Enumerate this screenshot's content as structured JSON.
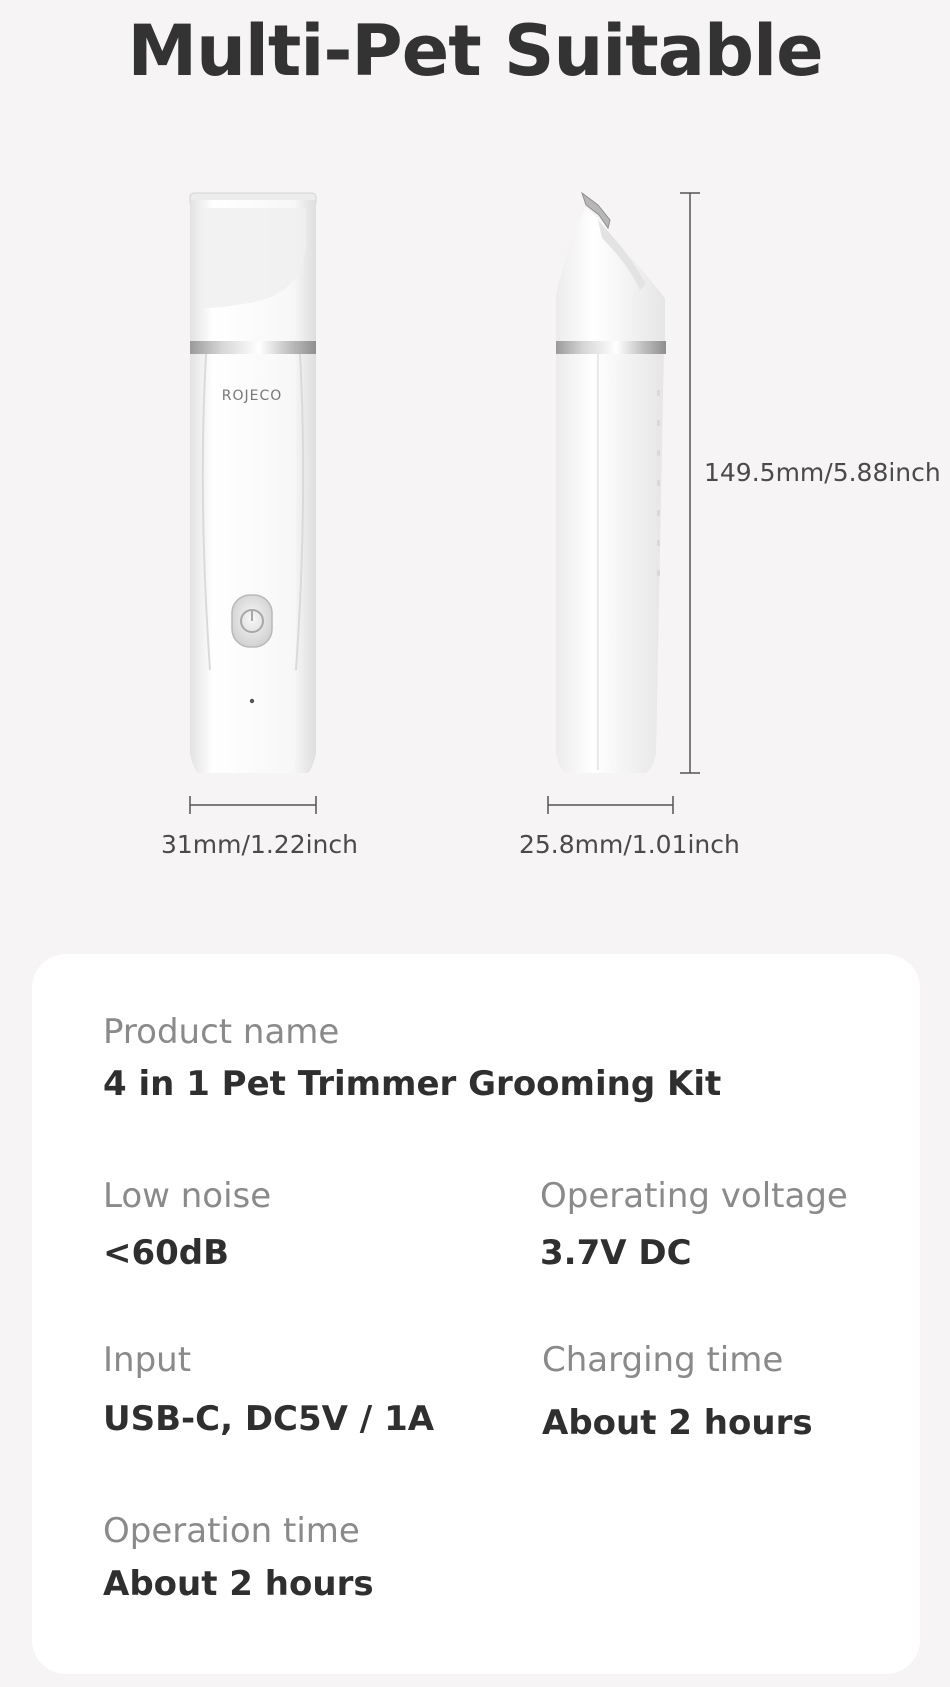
{
  "page": {
    "title": "Multi-Pet Suitable"
  },
  "product": {
    "brand": "ROJECO",
    "dimensions": {
      "height": "149.5mm/5.88inch",
      "front_width": "31mm/1.22inch",
      "side_width": "25.8mm/1.01inch"
    }
  },
  "specs": {
    "product_name": {
      "label": "Product name",
      "value": "4 in 1 Pet Trimmer Grooming Kit"
    },
    "low_noise": {
      "label": "Low noise",
      "value": "<60dB"
    },
    "operating_voltage": {
      "label": "Operating voltage",
      "value": "3.7V DC"
    },
    "input": {
      "label": "Input",
      "value": "USB-C, DC5V / 1A"
    },
    "charging_time": {
      "label": "Charging time",
      "value": "About 2 hours"
    },
    "operation_time": {
      "label": "Operation time",
      "value": "About 2 hours"
    }
  },
  "colors": {
    "background": "#f6f4f5",
    "card": "#ffffff",
    "title": "#333333",
    "label": "#8a8a8a",
    "value": "#2f2f2f"
  }
}
